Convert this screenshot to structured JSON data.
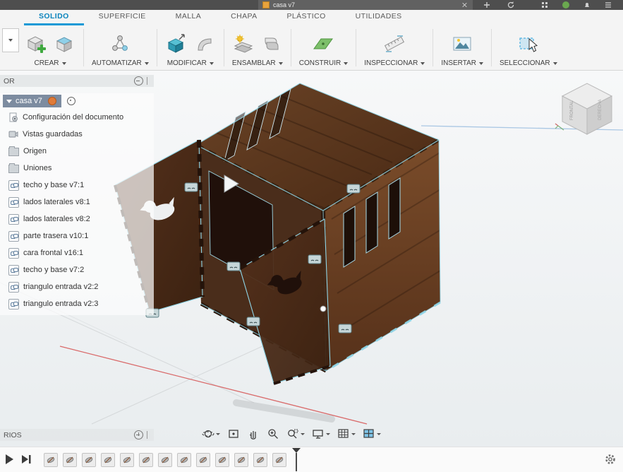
{
  "titlebar": {
    "tab_title": "casa v7"
  },
  "ribbon": {
    "tabs": [
      {
        "label": "SOLIDO",
        "active": true
      },
      {
        "label": "SUPERFICIE"
      },
      {
        "label": "MALLA"
      },
      {
        "label": "CHAPA"
      },
      {
        "label": "PLÁSTICO"
      },
      {
        "label": "UTILIDADES"
      }
    ],
    "groups": [
      {
        "label": "CREAR"
      },
      {
        "label": "AUTOMATIZAR"
      },
      {
        "label": "MODIFICAR"
      },
      {
        "label": "ENSAMBLAR"
      },
      {
        "label": "CONSTRUIR"
      },
      {
        "label": "INSPECCIONAR"
      },
      {
        "label": "INSERTAR"
      },
      {
        "label": "SELECCIONAR"
      }
    ]
  },
  "browser": {
    "header_text": "OR",
    "root_label": "casa v7",
    "items": [
      {
        "label": "Configuración del documento",
        "icon": "document-settings"
      },
      {
        "label": "Vistas guardadas",
        "icon": "saved-views"
      },
      {
        "label": "Origen",
        "icon": "folder"
      },
      {
        "label": "Uniones",
        "icon": "folder"
      },
      {
        "label": "techo y base v7:1",
        "icon": "linked-component"
      },
      {
        "label": "lados laterales v8:1",
        "icon": "linked-component"
      },
      {
        "label": "lados laterales v8:2",
        "icon": "linked-component"
      },
      {
        "label": "parte trasera v10:1",
        "icon": "linked-component"
      },
      {
        "label": "cara frontal v16:1",
        "icon": "linked-component"
      },
      {
        "label": "techo y base v7:2",
        "icon": "linked-component"
      },
      {
        "label": "triangulo entrada v2:2",
        "icon": "linked-component"
      },
      {
        "label": "triangulo entrada v2:3",
        "icon": "linked-component"
      }
    ]
  },
  "comments": {
    "header_text": "RIOS"
  },
  "viewcube": {
    "front_label": "FRONTAL",
    "right_label": "DERECHA"
  },
  "nav_toolbar": {
    "icons": [
      "orbit",
      "look-at",
      "pan",
      "zoom",
      "window-zoom",
      "display-settings",
      "grid-display",
      "viewports"
    ]
  },
  "timeline": {
    "feature_icon": "component-feature",
    "feature_count": 13
  },
  "colors": {
    "accent_blue": "#0696d7",
    "selection_teal": "#8fd6e8",
    "wood_dark": "#4e2d17",
    "warning_orange": "#e07b39"
  }
}
